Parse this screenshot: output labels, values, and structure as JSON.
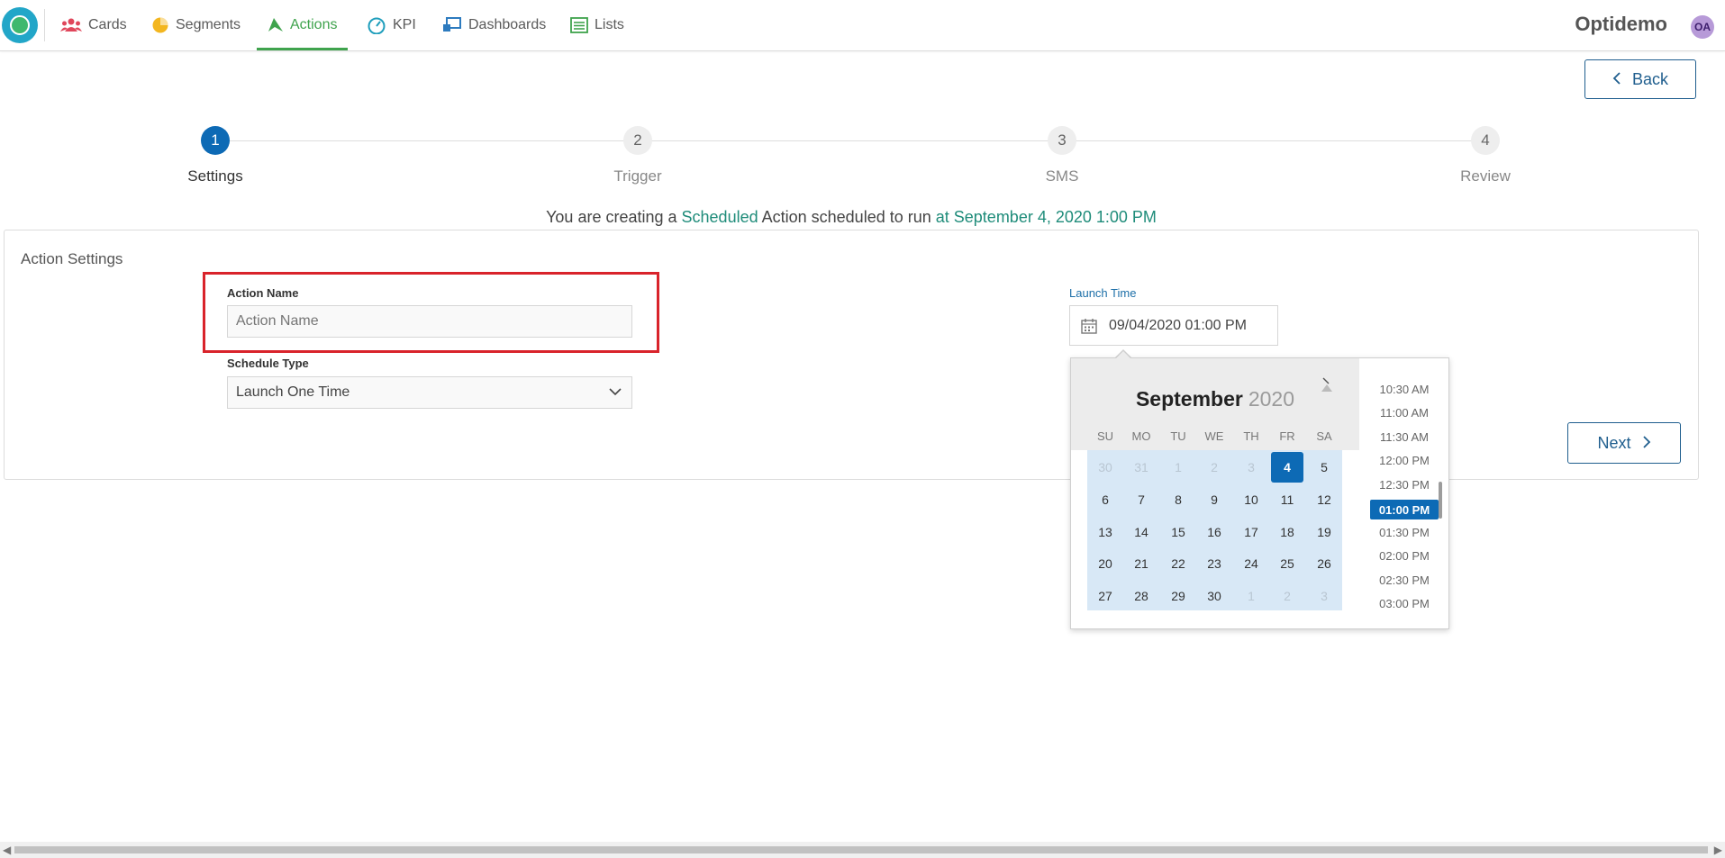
{
  "nav": {
    "items": [
      {
        "label": "Cards",
        "icon": "users-icon",
        "color": "#e0465b"
      },
      {
        "label": "Segments",
        "icon": "pie-chart-icon",
        "color": "#f3b61f"
      },
      {
        "label": "Actions",
        "icon": "paper-plane-icon",
        "color": "#3fa34d"
      },
      {
        "label": "KPI",
        "icon": "speedometer-icon",
        "color": "#1f9ebc"
      },
      {
        "label": "Dashboards",
        "icon": "dashboard-icon",
        "color": "#2d7bbf"
      },
      {
        "label": "Lists",
        "icon": "list-icon",
        "color": "#3fa34d"
      }
    ],
    "active": "Actions",
    "brand": "Optidemo",
    "avatar_initials": "OA"
  },
  "back_label": "Back",
  "steps": [
    {
      "number": "1",
      "label": "Settings",
      "active": true
    },
    {
      "number": "2",
      "label": "Trigger",
      "active": false
    },
    {
      "number": "3",
      "label": "SMS",
      "active": false
    },
    {
      "number": "4",
      "label": "Review",
      "active": false
    }
  ],
  "summary": {
    "prefix": "You are creating a",
    "type": "Scheduled",
    "middle": "Action scheduled to run",
    "when": "at September 4, 2020 1:00 PM"
  },
  "panel": {
    "title": "Action Settings",
    "action_name_label": "Action Name",
    "action_name_placeholder": "Action Name",
    "schedule_type_label": "Schedule Type",
    "schedule_type_value": "Launch One Time",
    "launch_time_label": "Launch Time",
    "launch_time_value": "09/04/2020 01:00 PM",
    "next_label": "Next"
  },
  "picker": {
    "month": "September",
    "year": "2020",
    "weekdays": [
      "SU",
      "MO",
      "TU",
      "WE",
      "TH",
      "FR",
      "SA"
    ],
    "weeks": [
      [
        "30",
        "31",
        "1",
        "2",
        "3",
        "4",
        "5"
      ],
      [
        "6",
        "7",
        "8",
        "9",
        "10",
        "11",
        "12"
      ],
      [
        "13",
        "14",
        "15",
        "16",
        "17",
        "18",
        "19"
      ],
      [
        "20",
        "21",
        "22",
        "23",
        "24",
        "25",
        "26"
      ],
      [
        "27",
        "28",
        "29",
        "30",
        "1",
        "2",
        "3"
      ]
    ],
    "selected_day": "4",
    "times": [
      "10:30 AM",
      "11:00 AM",
      "11:30 AM",
      "12:00 PM",
      "12:30 PM",
      "01:00 PM",
      "01:30 PM",
      "02:00 PM",
      "02:30 PM",
      "03:00 PM"
    ],
    "selected_time": "01:00 PM"
  },
  "colors": {
    "primary": "#0d6ab5",
    "accent_green": "#3fa34d",
    "highlight_red": "#d9232b"
  }
}
